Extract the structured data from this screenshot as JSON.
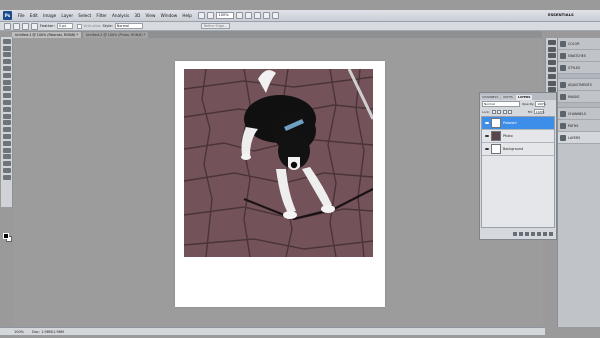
{
  "app": {
    "logo": "Ps",
    "workspace_label": "ESSENTIALS",
    "zoom_menu_value": "100%"
  },
  "menu": [
    "File",
    "Edit",
    "Image",
    "Layer",
    "Select",
    "Filter",
    "Analysis",
    "3D",
    "View",
    "Window",
    "Help"
  ],
  "options": {
    "feather_label": "Feather:",
    "feather_value": "0 px",
    "anti_alias_label": "Anti-alias",
    "style_label": "Style:",
    "style_value": "Normal",
    "refine_edge_label": "Refine Edge..."
  },
  "tabs": [
    {
      "label": "Untitled-1 @ 100% (Polaroid, RGB/8) *"
    },
    {
      "label": "Untitled-2 @ 100% (Photo, RGB/8) *"
    }
  ],
  "layers_panel": {
    "tabs": [
      "CHANNELS",
      "PATHS",
      "LAYERS"
    ],
    "blend_mode": "Normal",
    "opacity_label": "Opacity:",
    "opacity_value": "100%",
    "lock_label": "Lock:",
    "fill_label": "Fill:",
    "fill_value": "100%",
    "layers": [
      {
        "name": "Polaroid",
        "selected": true
      },
      {
        "name": "Photo",
        "selected": false
      },
      {
        "name": "Background",
        "selected": false
      }
    ]
  },
  "dock": {
    "group1": [
      "COLOR",
      "SWATCHES",
      "STYLES"
    ],
    "group2": [
      "ADJUSTMENTS",
      "MASKS"
    ],
    "group3": [
      "CHANNELS",
      "PATHS",
      "LAYERS"
    ]
  },
  "status": {
    "zoom": "100%",
    "doc_info": "Doc: 1.98M/1.98M"
  },
  "colors": {
    "selected_layer": "#3d8ee8",
    "canvas_bg": "#9c9c9c"
  }
}
